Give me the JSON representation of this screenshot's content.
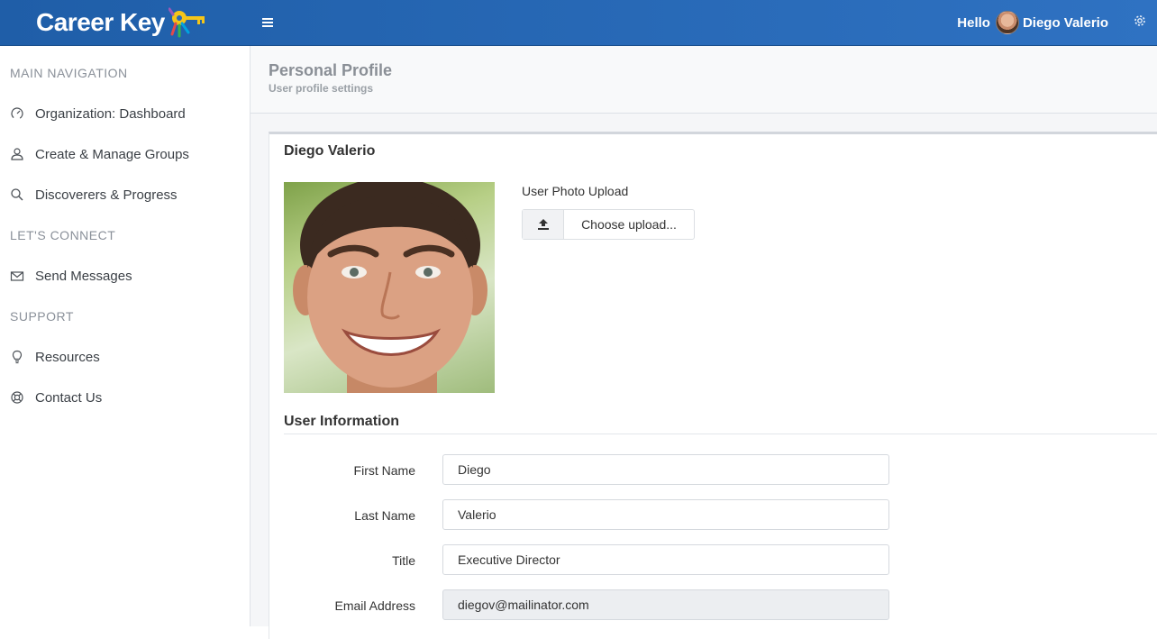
{
  "app": {
    "logo_text": "Career Key",
    "greeting": "Hello",
    "user_name": "Diego Valerio"
  },
  "icons": {
    "menu": "hamburger-icon",
    "settings": "gear-icon",
    "upload": "upload-icon"
  },
  "sidebar": {
    "sections": [
      {
        "header": "MAIN NAVIGATION",
        "items": [
          {
            "label": "Organization: Dashboard",
            "icon": "dashboard-gauge-icon"
          },
          {
            "label": "Create & Manage Groups",
            "icon": "user-icon"
          },
          {
            "label": "Discoverers & Progress",
            "icon": "search-icon"
          }
        ]
      },
      {
        "header": "LET'S CONNECT",
        "items": [
          {
            "label": "Send Messages",
            "icon": "envelope-icon"
          }
        ]
      },
      {
        "header": "SUPPORT",
        "items": [
          {
            "label": "Resources",
            "icon": "lightbulb-icon"
          },
          {
            "label": "Contact Us",
            "icon": "lifebuoy-icon"
          }
        ]
      }
    ]
  },
  "page": {
    "title": "Personal Profile",
    "subtitle": "User profile settings"
  },
  "profile": {
    "name": "Diego Valerio",
    "upload_label": "User Photo Upload",
    "upload_button": "Choose upload...",
    "section_title": "User Information",
    "fields": [
      {
        "label": "First Name",
        "value": "Diego"
      },
      {
        "label": "Last Name",
        "value": "Valerio"
      },
      {
        "label": "Title",
        "value": "Executive Director"
      },
      {
        "label": "Email Address",
        "value": "diegov@mailinator.com"
      }
    ]
  },
  "colors": {
    "topbar": "#2a69b8",
    "accent_yellow": "#f5c518",
    "sidebar_header": "#8a9099"
  }
}
